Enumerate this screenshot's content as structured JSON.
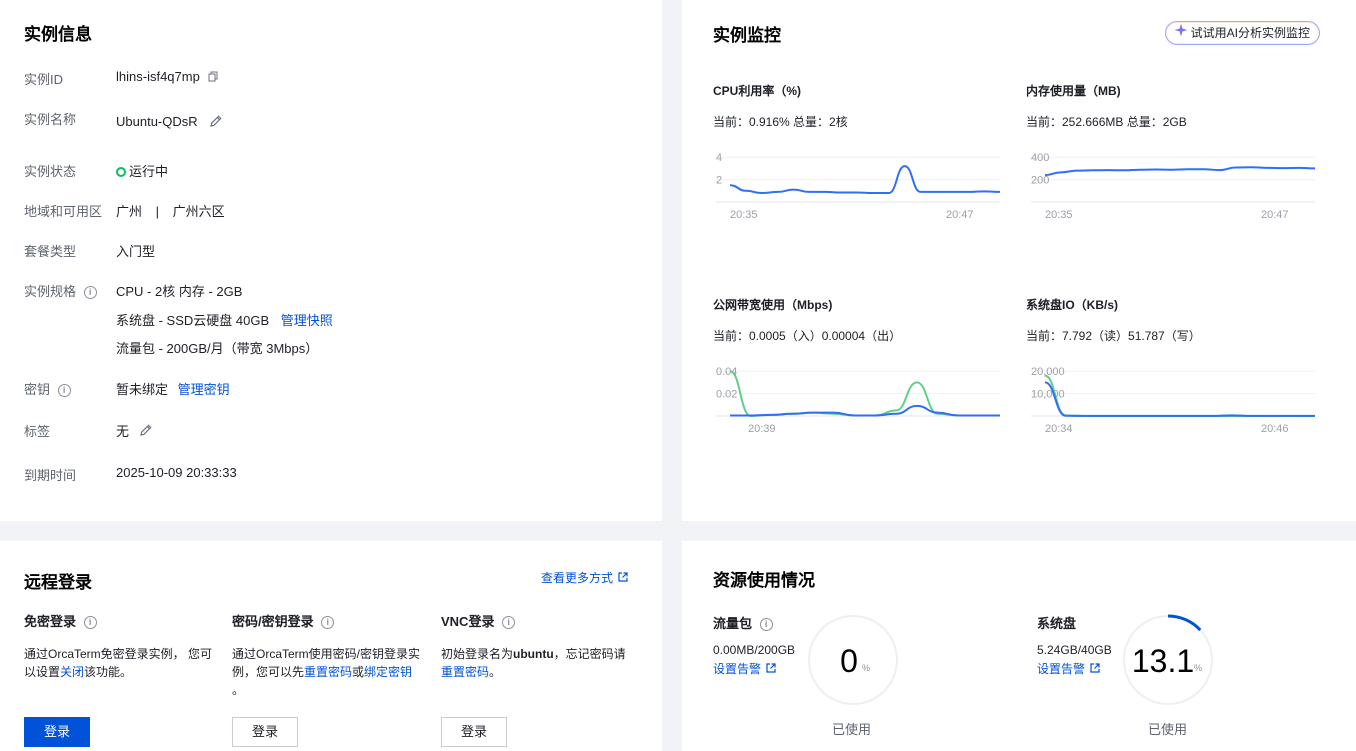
{
  "info": {
    "title": "实例信息",
    "rows": {
      "id_label": "实例ID",
      "id_value": "lhins-isf4q7mp",
      "name_label": "实例名称",
      "name_value": "Ubuntu-QDsR",
      "status_label": "实例状态",
      "status_value": "运行中",
      "region_label": "地域和可用区",
      "region_value": "广州",
      "region_sep": "|",
      "zone_value": "广州六区",
      "plan_label": "套餐类型",
      "plan_value": "入门型",
      "spec_label": "实例规格",
      "spec_cpu": "CPU - 2核 内存 - 2GB",
      "spec_disk": "系统盘 - SSD云硬盘 40GB",
      "spec_disk_link": "管理快照",
      "spec_traffic": "流量包 - 200GB/月（带宽 3Mbps）",
      "key_label": "密钥",
      "key_value": "暂未绑定",
      "key_link": "管理密钥",
      "tag_label": "标签",
      "tag_value": "无",
      "expire_label": "到期时间",
      "expire_value": "2025-10-09 20:33:33"
    }
  },
  "monitor": {
    "title": "实例监控",
    "ai_button": "试试用AI分析实例监控",
    "charts": [
      {
        "title": "CPU利用率（%)",
        "current": "当前：0.916% 总量：2核",
        "yticks": [
          "4",
          "2"
        ],
        "xticks": [
          "20:35",
          "20:47"
        ]
      },
      {
        "title": "内存使用量（MB)",
        "current": "当前：252.666MB 总量：2GB",
        "yticks": [
          "400",
          "200"
        ],
        "xticks": [
          "20:35",
          "20:47"
        ]
      },
      {
        "title": "公网带宽使用（Mbps)",
        "current": "当前：0.0005（入）0.00004（出）",
        "yticks": [
          "0.04",
          "0.02"
        ],
        "xticks": [
          "20:39"
        ]
      },
      {
        "title": "系统盘IO（KB/s)",
        "current": "当前：7.792（读）51.787（写）",
        "yticks": [
          "20,000",
          "10,000"
        ],
        "xticks": [
          "20:34",
          "20:46"
        ]
      }
    ]
  },
  "chart_data": [
    {
      "type": "line",
      "title": "CPU利用率（%)",
      "x": [
        "20:35",
        "20:47"
      ],
      "ylim": [
        0,
        5
      ],
      "series": [
        {
          "values": [
            1.5,
            1.0,
            0.8,
            0.9,
            1.1,
            0.9,
            0.9,
            0.85,
            0.85,
            0.8,
            0.8,
            3.2,
            0.9,
            0.9,
            0.9,
            0.9,
            0.95,
            0.9
          ]
        }
      ]
    },
    {
      "type": "line",
      "title": "内存使用量（MB)",
      "x": [
        "20:35",
        "20:47"
      ],
      "ylim": [
        0,
        500
      ],
      "series": [
        {
          "values": [
            240,
            265,
            280,
            283,
            285,
            283,
            288,
            290,
            288,
            292,
            292,
            285,
            308,
            310,
            305,
            302,
            305,
            300
          ]
        }
      ]
    },
    {
      "type": "line",
      "title": "公网带宽使用（Mbps)",
      "x": [
        "20:39"
      ],
      "ylim": [
        0,
        0.05
      ],
      "series": [
        {
          "values": [
            0.0005,
            0.0005,
            0.001,
            0.002,
            0.003,
            0.003,
            0.0005,
            0.0005,
            0.002,
            0.009,
            0.003,
            0.0005,
            0.0005,
            0.0005
          ]
        },
        {
          "values": [
            0.04,
            0.0,
            0.001,
            0.002,
            0.003,
            0.002,
            0.0005,
            0.0005,
            0.005,
            0.03,
            0.002,
            0.0005,
            0.0005,
            0.0005
          ]
        }
      ]
    },
    {
      "type": "line",
      "title": "系统盘IO（KB/s)",
      "x": [
        "20:34",
        "20:46"
      ],
      "ylim": [
        0,
        25000
      ],
      "series": [
        {
          "values": [
            15000,
            100,
            50,
            50,
            60,
            60,
            50,
            50,
            50,
            300,
            50,
            50,
            50,
            50
          ]
        },
        {
          "values": [
            18000,
            200,
            0,
            0,
            0,
            0,
            0,
            0,
            0,
            0,
            0,
            0,
            0,
            0
          ]
        }
      ]
    }
  ],
  "login": {
    "title": "远程登录",
    "more_link": "查看更多方式",
    "cols": [
      {
        "heading": "免密登录",
        "desc_pre": "通过OrcaTerm免密登录实例，  您可以设置",
        "desc_link": "关闭",
        "desc_post": "该功能。",
        "button": "登录"
      },
      {
        "heading": "密码/密钥登录",
        "desc_pre": "通过OrcaTerm使用密码/密钥登录实例，您可以先",
        "desc_link": "重置密码",
        "desc_mid": "或",
        "desc_link2": "绑定密钥",
        "desc_post": "。",
        "button": "登录"
      },
      {
        "heading": "VNC登录",
        "desc_pre": "初始登录名为",
        "desc_bold": "ubuntu",
        "desc_mid": "，忘记密码请",
        "desc_link": "重置密码",
        "desc_post": "。",
        "button": "登录"
      }
    ]
  },
  "resources": {
    "title": "资源使用情况",
    "traffic": {
      "label": "流量包",
      "usage": "0.00MB/200GB",
      "alert_link": "设置告警",
      "percent": "0",
      "percent_value": 0,
      "unit": "%",
      "caption": "已使用"
    },
    "disk": {
      "label": "系统盘",
      "usage": "5.24GB/40GB",
      "alert_link": "设置告警",
      "percent": "13.1",
      "percent_value": 13.1,
      "unit": "%",
      "caption": "已使用"
    },
    "colors": {
      "accent": "#0052d9",
      "ring_bg": "#eeeff2"
    }
  }
}
